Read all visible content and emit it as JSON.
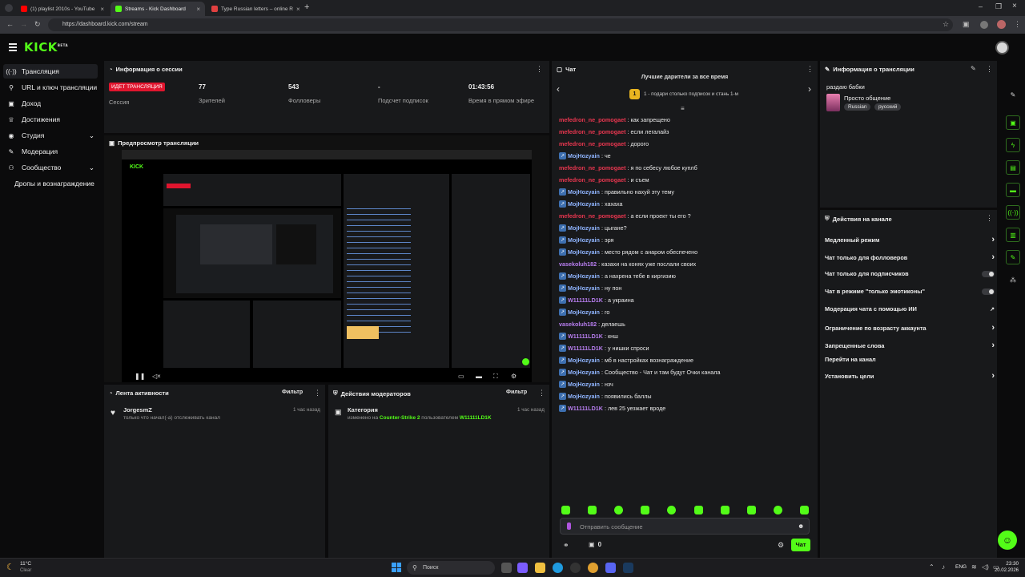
{
  "browser": {
    "tabs": [
      {
        "title": "(1) playlist 2010s - YouTube",
        "color": "#ff0000"
      },
      {
        "title": "Streams - Kick Dashboard",
        "color": "#53fc18"
      },
      {
        "title": "Type Russian letters – online R",
        "color": "#e04040"
      }
    ],
    "url": "https://dashboard.kick.com/stream"
  },
  "app": {
    "logo": "KICK",
    "logo_beta": "BETA"
  },
  "sidebar": {
    "items": [
      {
        "label": "Трансляция",
        "icon": "broadcast-icon"
      },
      {
        "label": "URL и ключ трансляции",
        "icon": "key-icon"
      },
      {
        "label": "Доход",
        "icon": "money-icon"
      },
      {
        "label": "Достижения",
        "icon": "trophy-icon"
      },
      {
        "label": "Студия",
        "icon": "studio-icon"
      },
      {
        "label": "Модерация",
        "icon": "wrench-icon"
      },
      {
        "label": "Сообщество",
        "icon": "community-icon"
      },
      {
        "label": "Дропы и вознаграждение",
        "icon": ""
      }
    ]
  },
  "session": {
    "title": "Информация о сессии",
    "live_badge": "ИДЕТ ТРАНСЛЯЦИЯ",
    "stats": [
      {
        "value": "",
        "label": "Сессия"
      },
      {
        "value": "77",
        "label": "Зрителей"
      },
      {
        "value": "543",
        "label": "Фолловеры"
      },
      {
        "value": "-",
        "label": "Подсчет подписок"
      },
      {
        "value": "01:43:56",
        "label": "Время в прямом эфире"
      }
    ]
  },
  "preview": {
    "title": "Предпросмотр трансляции"
  },
  "activity": {
    "title": "Лента активности",
    "filter": "Фильтр",
    "items": [
      {
        "user": "JorgesmZ",
        "text": "только что начал(-а) отслеживать канал",
        "time": "1 час назад"
      }
    ]
  },
  "modactions": {
    "title": "Действия модераторов",
    "filter": "Фильтр",
    "items": [
      {
        "title": "Категория",
        "text1": "изменено на ",
        "game": "Counter-Strike 2",
        "text2": " пользователем ",
        "user": "W11111LD1K",
        "time": "1 час назад"
      }
    ]
  },
  "chat": {
    "title": "Чат",
    "banner_title": "Лучшие дарители за все время",
    "banner_rank": "1",
    "banner_text": "1 - подари столько подписок и стань 1-м",
    "messages": [
      {
        "user": "mefedron_ne_pomogaet",
        "text": "как запрещено",
        "color": "#e8364f",
        "badge": false
      },
      {
        "user": "mefedron_ne_pomogaet",
        "text": "если легалайз",
        "color": "#e8364f",
        "badge": false
      },
      {
        "user": "mefedron_ne_pomogaet",
        "text": "дорого",
        "color": "#e8364f",
        "badge": false
      },
      {
        "user": "MojHozyain",
        "text": "че",
        "color": "#8fb4ff",
        "badge": true
      },
      {
        "user": "mefedron_ne_pomogaet",
        "text": "я по себесу любое куплб",
        "color": "#e8364f",
        "badge": false
      },
      {
        "user": "mefedron_ne_pomogaet",
        "text": "и съем",
        "color": "#e8364f",
        "badge": false
      },
      {
        "user": "MojHozyain",
        "text": "правильно нахуй эту тему",
        "color": "#8fb4ff",
        "badge": true
      },
      {
        "user": "MojHozyain",
        "text": "хахаха",
        "color": "#8fb4ff",
        "badge": true
      },
      {
        "user": "mefedron_ne_pomogaet",
        "text": "а если проект ты его ?",
        "color": "#e8364f",
        "badge": false
      },
      {
        "user": "MojHozyain",
        "text": "цыгане?",
        "color": "#8fb4ff",
        "badge": true
      },
      {
        "user": "MojHozyain",
        "text": "эря",
        "color": "#8fb4ff",
        "badge": true
      },
      {
        "user": "MojHozyain",
        "text": "место рядом с анаром обеспечено",
        "color": "#8fb4ff",
        "badge": true
      },
      {
        "user": "vasekoluh182",
        "text": "казахи на конях уже послали своих",
        "color": "#b87ef0",
        "badge": false
      },
      {
        "user": "MojHozyain",
        "text": "а нахрена тебе в киргизию",
        "color": "#8fb4ff",
        "badge": true
      },
      {
        "user": "MojHozyain",
        "text": "ну пон",
        "color": "#8fb4ff",
        "badge": true
      },
      {
        "user": "W11111LD1K",
        "text": "а украина",
        "color": "#b87ef0",
        "badge": true
      },
      {
        "user": "MojHozyain",
        "text": "го",
        "color": "#8fb4ff",
        "badge": true
      },
      {
        "user": "vasekoluh182",
        "text": "делаешь",
        "color": "#b87ef0",
        "badge": false
      },
      {
        "user": "W11111LD1K",
        "text": "кнш",
        "color": "#b87ef0",
        "badge": true
      },
      {
        "user": "W11111LD1K",
        "text": "у нишки спроси",
        "color": "#b87ef0",
        "badge": true
      },
      {
        "user": "MojHozyain",
        "text": "мб в настройках вознаграждение",
        "color": "#8fb4ff",
        "badge": true
      },
      {
        "user": "MojHozyain",
        "text": "Сообщество - Чат и там будут Очки канала",
        "color": "#8fb4ff",
        "badge": true
      },
      {
        "user": "MojHozyain",
        "text": "нзч",
        "color": "#8fb4ff",
        "badge": true
      },
      {
        "user": "MojHozyain",
        "text": "появились баллы",
        "color": "#8fb4ff",
        "badge": true
      },
      {
        "user": "W11111LD1K",
        "text": "лев 25 уезжает вроде",
        "color": "#b87ef0",
        "badge": true
      }
    ],
    "input_placeholder": "Отправить сообщение",
    "points": "0",
    "send_label": "Чат"
  },
  "streaminfo": {
    "title": "Информация о трансляции",
    "stream_title": "раздаю бабки",
    "category": "Просто общение",
    "tags": [
      "Russian",
      "русский"
    ]
  },
  "channel_actions": {
    "title": "Действия на канале",
    "items": [
      {
        "label": "Медленный режим",
        "control": "chevron"
      },
      {
        "label": "Чат только для фолловеров",
        "control": "chevron"
      },
      {
        "label": "Чат только для подписчиков",
        "control": "toggle"
      },
      {
        "label": "Чат в режиме \"только эмотиконы\"",
        "control": "toggle"
      },
      {
        "label": "Модерация чата с помощью ИИ",
        "control": "external"
      },
      {
        "label": "Ограничение по возрасту аккаунта",
        "control": "chevron"
      },
      {
        "label": "Запрещенные слова",
        "control": "chevron"
      },
      {
        "label": "Перейти на канал",
        "control": "none"
      },
      {
        "label": "Установить цели",
        "control": "chevron"
      }
    ]
  },
  "taskbar": {
    "weather_temp": "11°C",
    "weather_text": "Clear",
    "search": "Поиск",
    "lang": "ENG",
    "time": "23:30",
    "date": "20.02.2026"
  },
  "colors": {
    "accent": "#53fc18",
    "live": "#e0152e",
    "panel": "#18191b"
  }
}
